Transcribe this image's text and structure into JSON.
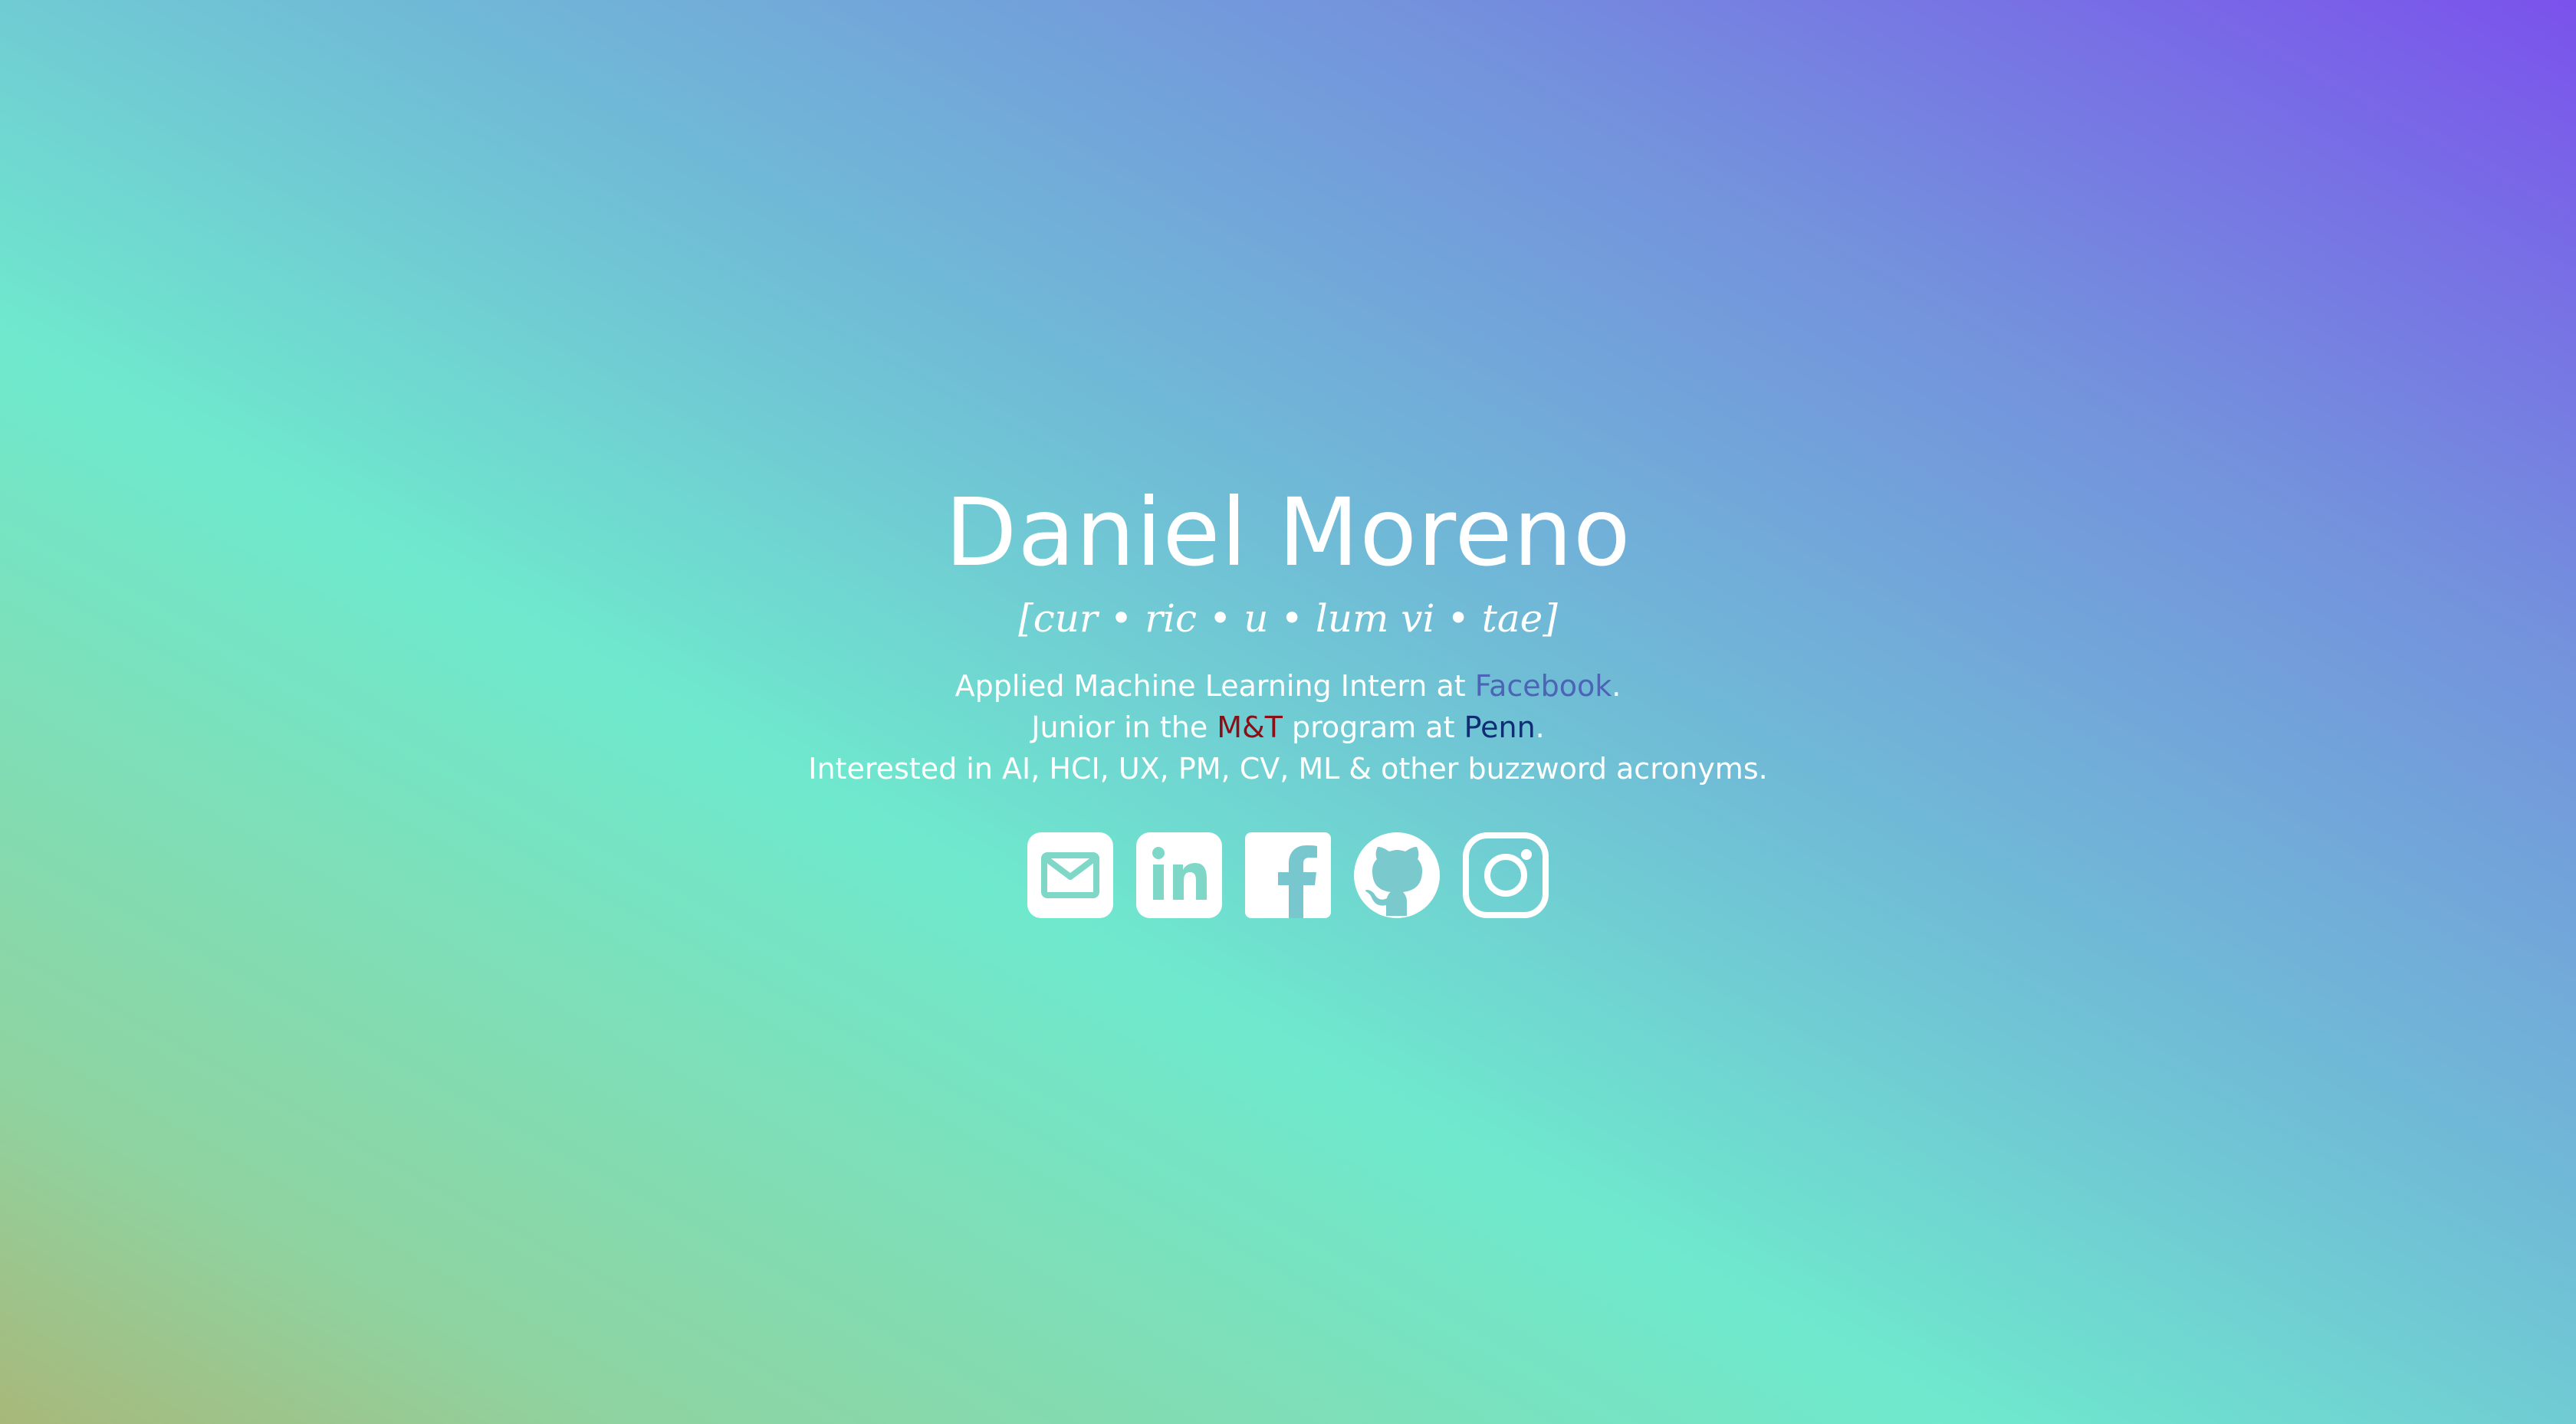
{
  "profile": {
    "name": "Daniel Moreno",
    "pronunciation": "[cur • ric • u • lum vi • tae]"
  },
  "bio": {
    "line1": {
      "prefix": "Applied Machine Learning Intern at ",
      "link_label": "Facebook",
      "suffix": "."
    },
    "line2": {
      "prefix": "Junior in the ",
      "program_label": "M&T",
      "middle": " program at ",
      "school_label": "Penn",
      "suffix": "."
    },
    "line3": "Interested in AI, HCI, UX, PM, CV, ML & other buzzword acronyms."
  },
  "social": {
    "items": [
      {
        "icon": "email-icon"
      },
      {
        "icon": "linkedin-icon"
      },
      {
        "icon": "facebook-icon"
      },
      {
        "icon": "github-icon"
      },
      {
        "icon": "instagram-icon"
      }
    ]
  },
  "colors": {
    "gradient": [
      "#a8b87a",
      "#6fe9cd",
      "#7490dd",
      "#7b52ec"
    ],
    "text": "#ffffff",
    "facebook_link": "#4c63b6",
    "mt_link": "#8b0f16",
    "penn_link": "#0e2d73"
  }
}
